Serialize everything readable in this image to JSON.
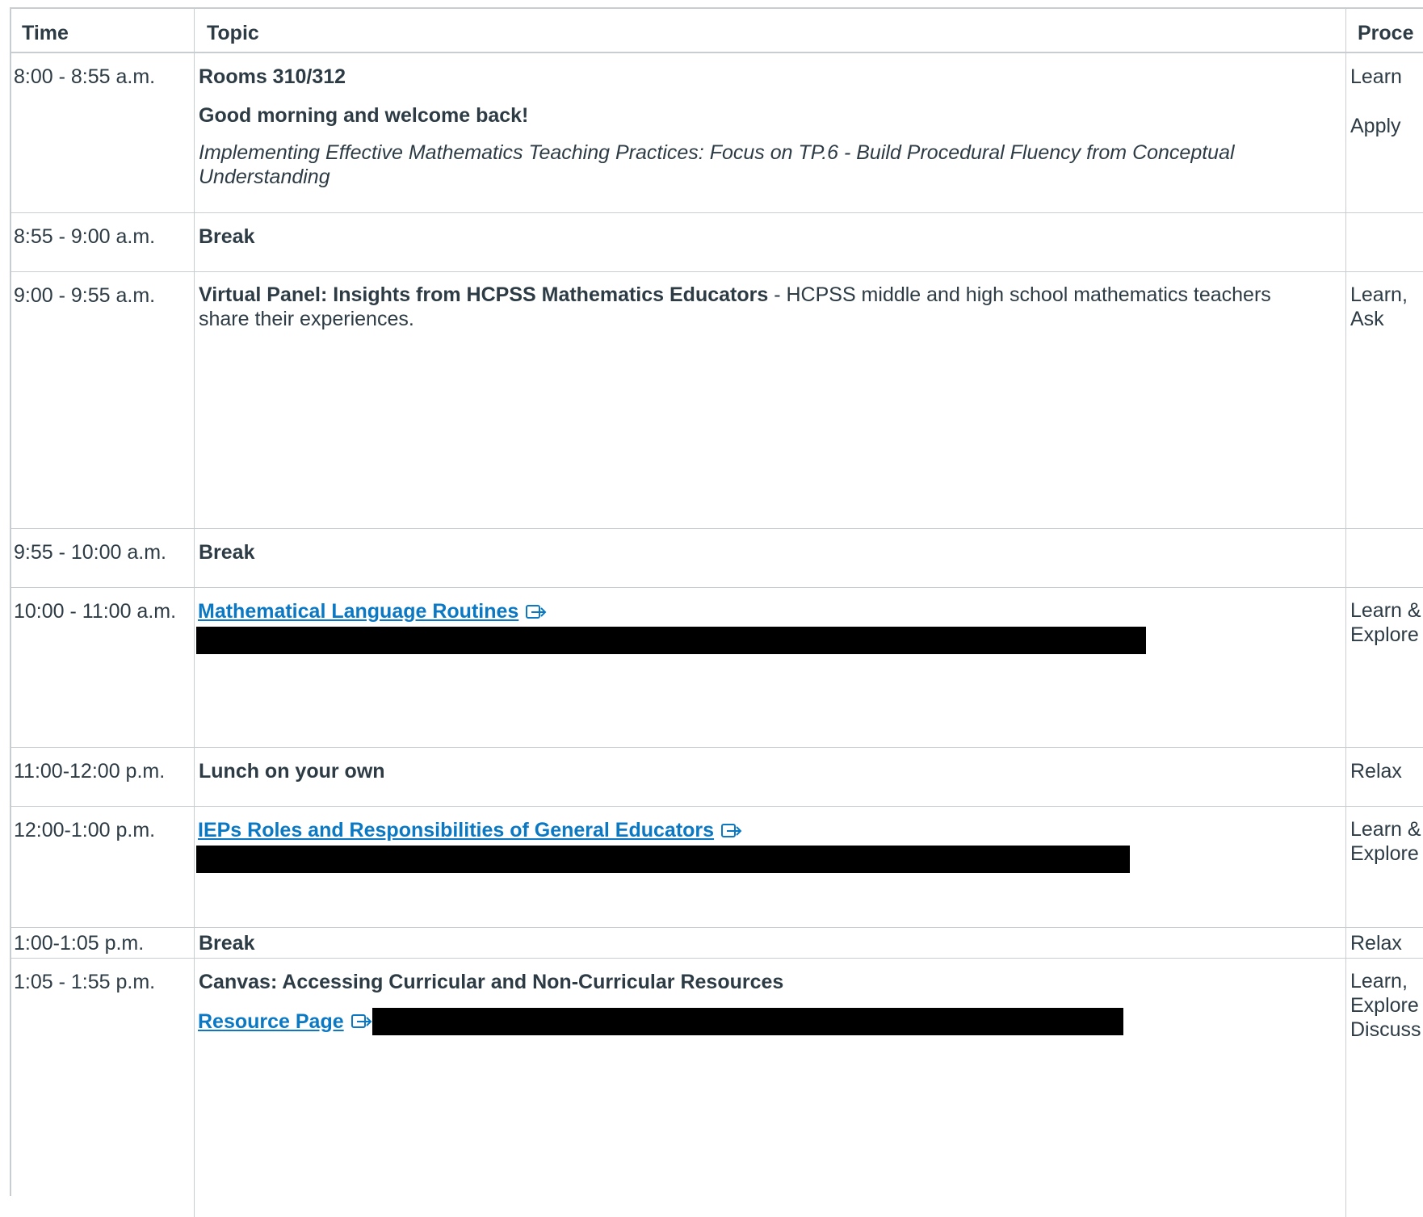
{
  "header": {
    "time": "Time",
    "topic": "Topic",
    "process": "Proce"
  },
  "rows": [
    {
      "time": "8:00 - 8:55 a.m.",
      "room": "Rooms 310/312",
      "welcome": "Good morning and welcome back!",
      "subtitle": "Implementing Effective Mathematics Teaching Practices: Focus on TP.6 - Build Procedural Fluency from Conceptual Understanding",
      "process": [
        "Learn",
        "Apply"
      ]
    },
    {
      "time": "8:55 - 9:00 a.m.",
      "title": "Break",
      "process": [
        ""
      ]
    },
    {
      "time": "9:00 - 9:55 a.m.",
      "title": "Virtual Panel: Insights from HCPSS Mathematics Educators",
      "description": " - HCPSS middle and high school mathematics teachers share their experiences.",
      "process": [
        "Learn,",
        "Ask"
      ]
    },
    {
      "time": "9:55 - 10:00 a.m.",
      "title": "Break",
      "process": [
        ""
      ]
    },
    {
      "time": "10:00 - 11:00 a.m.",
      "link": "Mathematical Language Routines",
      "icon": "external-link-icon",
      "process": [
        "Learn &",
        "Explore"
      ]
    },
    {
      "time": "11:00-12:00 p.m.",
      "title": "Lunch on your own",
      "process": [
        "Relax"
      ]
    },
    {
      "time": "12:00-1:00 p.m.",
      "link": "IEPs Roles and Responsibilities of General Educators",
      "icon": "external-link-icon",
      "process": [
        "Learn &",
        "Explore"
      ]
    },
    {
      "time": "1:00-1:05 p.m.",
      "title": "Break",
      "process": [
        "Relax"
      ]
    },
    {
      "time": "1:05 - 1:55 p.m.",
      "title": "Canvas: Accessing Curricular and Non-Curricular Resources",
      "link": "Resource Page",
      "icon": "external-link-icon",
      "process": [
        "Learn,",
        "Explore",
        "Discuss"
      ]
    }
  ],
  "colors": {
    "text": "#2d3b45",
    "link": "#0b78c4",
    "border": "#c7cdd1",
    "redaction": "#000000"
  }
}
